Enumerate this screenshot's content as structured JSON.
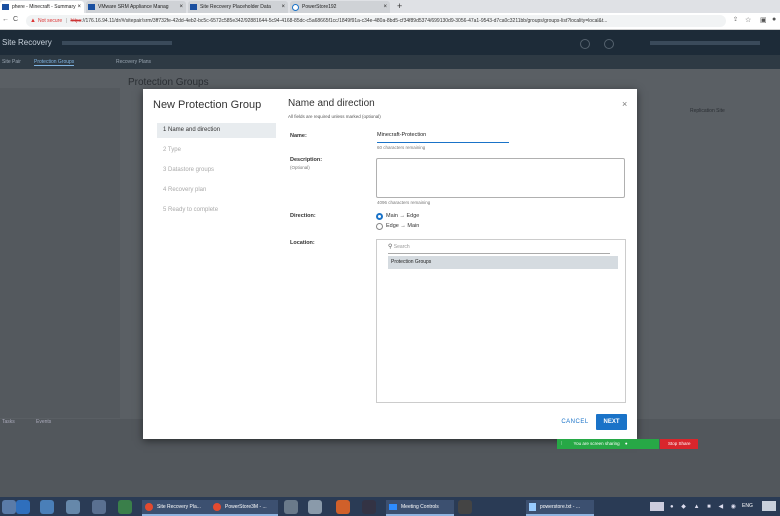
{
  "browser": {
    "tabs": [
      {
        "title": "phere - Minecraft - Summary"
      },
      {
        "title": "VMware SRM Appliance Manag"
      },
      {
        "title": "Site Recovery Placeholder Data"
      },
      {
        "title": "PowerStore192"
      }
    ],
    "new_tab": "+",
    "nav": {
      "back": "←",
      "reload": "C"
    },
    "security": "Not secure",
    "url_scheme": "https",
    "url": "://176.16.94.11/dr/#/sitepair/srm/3ff732fe-42dd-4eb2-bc5c-6572c585e342/92881644-5c94-4168-85dc-c5a68665f1cc/1849f91a-c34e-480a-8bd5-cf34f89d5374/699130d9-3056-47a1-9543-d7ca0c3211bb/groups/groups-list?locality=local&t..."
  },
  "app": {
    "title": "Site Recovery",
    "subnav": [
      "Site Pair",
      "Protection Groups",
      "Recovery Plans"
    ],
    "page_title": "Protection Groups",
    "bottom_tabs": [
      "Tasks",
      "Events"
    ],
    "table_header": "Replication Site"
  },
  "modal": {
    "title": "New Protection Group",
    "steps": [
      {
        "label": "1  Name and direction"
      },
      {
        "label": "2  Type"
      },
      {
        "label": "3  Datastore groups"
      },
      {
        "label": "4  Recovery plan"
      },
      {
        "label": "5  Ready to complete"
      }
    ],
    "panel_title": "Name and direction",
    "required_note": "All fields are required unless marked (optional)",
    "name_label": "Name:",
    "name_value": "Minecraft-Protection",
    "name_hint": "60 characters remaining",
    "desc_label": "Description:",
    "desc_optional": "(Optional)",
    "desc_hint": "4096 characters remaining",
    "direction_label": "Direction:",
    "direction_options": [
      "Main → Edge",
      "Edge → Main"
    ],
    "direction_selected": "Main → Edge",
    "location_label": "Location:",
    "search_placeholder": "Search",
    "location_items": [
      "Protection Groups"
    ],
    "cancel": "CANCEL",
    "next": "NEXT",
    "close": "×"
  },
  "sharing": {
    "message": "You are screen sharing",
    "stop": "Stop Share"
  },
  "taskbar": {
    "items": [
      "Site Recovery Pla...",
      "PowerStore3M - ...",
      "Meeting Controls",
      "powerstore.txt - ..."
    ],
    "lang": "ENG"
  }
}
